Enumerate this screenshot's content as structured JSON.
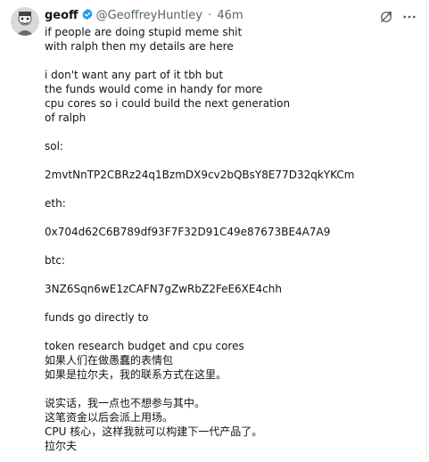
{
  "author": {
    "name": "geoff",
    "handle": "@GeoffreyHuntley",
    "separator": "·",
    "time": "46m"
  },
  "icons": {
    "verified": "verified-badge-icon",
    "grok": "grok-icon",
    "more": "more-icon",
    "accent": "#1d9bf0"
  },
  "tweet": {
    "lines": [
      "if people are doing stupid meme shit",
      "with ralph then my details are here",
      "",
      "i don't want any part of it tbh but",
      "the funds would come in handy for more",
      "cpu cores so i could build the next generation",
      "of ralph",
      "",
      "sol:",
      "",
      "2mvtNnTP2CBRz24q1BzmDX9cv2bQBsY8E77D32qkYKCm",
      "",
      "eth:",
      "",
      "0x704d62C6B789df93F7F32D91C49e87673BE4A7A9",
      "",
      "btc:",
      "",
      "3NZ6Sqn6wE1zCAFN7gZwRbZ2FeE6XE4chh",
      "",
      "funds go directly to",
      "",
      "token research budget and cpu cores",
      "如果人们在做愚蠢的表情包",
      "如果是拉尔夫，我的联系方式在这里。",
      "",
      "说实话，我一点也不想参与其中。",
      "这笔资金以后会派上用场。",
      "CPU 核心，这样我就可以构建下一代产品了。",
      "拉尔夫"
    ]
  }
}
